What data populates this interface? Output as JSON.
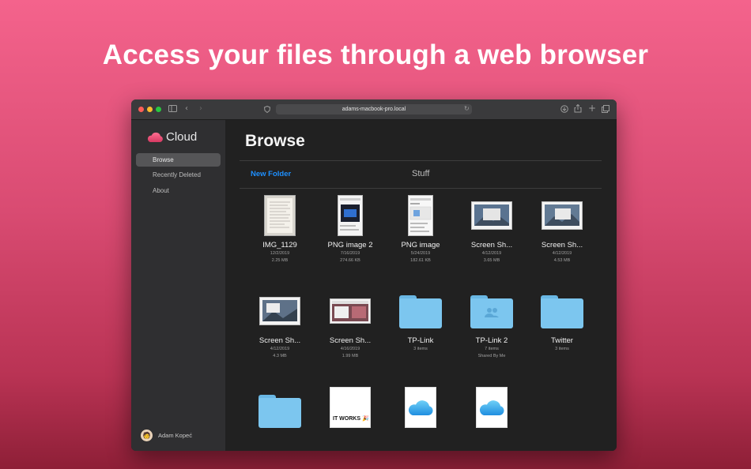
{
  "headline": "Access your files through a web browser",
  "browser": {
    "url": "adams-macbook-pro.local"
  },
  "sidebar": {
    "app_name": "Cloud",
    "items": [
      {
        "label": "Browse"
      },
      {
        "label": "Recently Deleted"
      },
      {
        "label": "About"
      }
    ],
    "user_name": "Adam Kopeć"
  },
  "main": {
    "title": "Browse",
    "new_folder_label": "New Folder",
    "current_folder": "Stuff"
  },
  "files": [
    {
      "name": "IMG_1129",
      "date": "12/2/2019",
      "detail": "2.25 MB",
      "kind": "photo"
    },
    {
      "name": "PNG image 2",
      "date": "7/16/2019",
      "detail": "274.66 KB",
      "kind": "screenshot"
    },
    {
      "name": "PNG image",
      "date": "5/24/2019",
      "detail": "182.61 KB",
      "kind": "screenshot"
    },
    {
      "name": "Screen Sh...",
      "date": "4/12/2019",
      "detail": "3.65 MB",
      "kind": "screenshot"
    },
    {
      "name": "Screen Sh...",
      "date": "4/12/2019",
      "detail": "4.53 MB",
      "kind": "screenshot"
    },
    {
      "name": "Screen Sh...",
      "date": "4/12/2019",
      "detail": "4.3 MB",
      "kind": "screenshot"
    },
    {
      "name": "Screen Sh...",
      "date": "4/16/2019",
      "detail": "1.99 MB",
      "kind": "screenshot"
    },
    {
      "name": "TP-Link",
      "date": "",
      "detail": "3 items",
      "kind": "folder"
    },
    {
      "name": "TP-Link 2",
      "date": "7 items",
      "detail": "Shared By Me",
      "kind": "shared-folder"
    },
    {
      "name": "Twitter",
      "date": "",
      "detail": "3 items",
      "kind": "folder"
    },
    {
      "name": "",
      "kind": "folder"
    },
    {
      "name": "",
      "kind": "image",
      "caption": "IT WORKS 🎉"
    },
    {
      "name": "",
      "kind": "cloud-image"
    },
    {
      "name": "",
      "kind": "cloud-image"
    }
  ],
  "colors": {
    "accent": "#1e90ff",
    "folder": "#7cc6ef",
    "background_top": "#f4638c",
    "background_bottom": "#8e1f37"
  }
}
